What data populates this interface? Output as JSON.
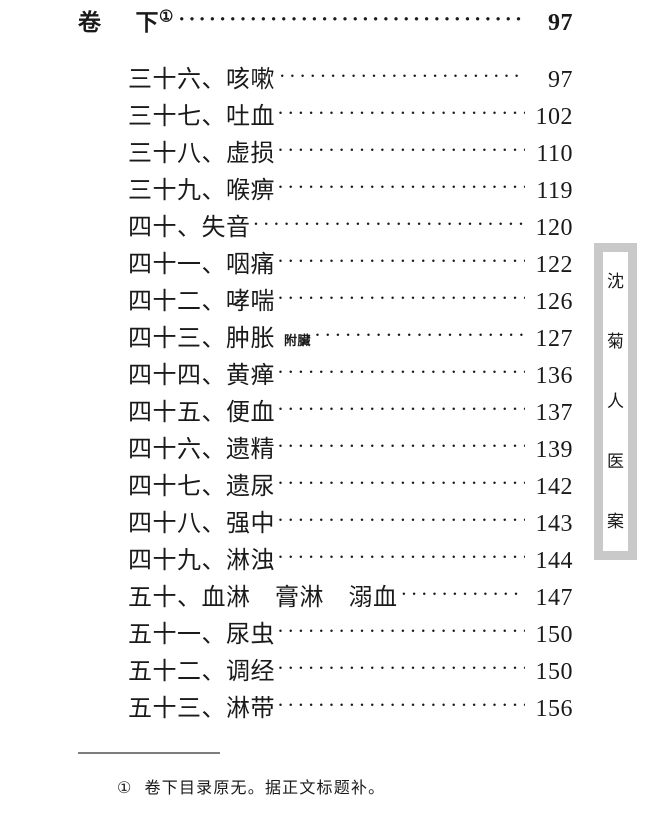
{
  "document": {
    "volume_header": {
      "prefix": "卷",
      "title": "下",
      "footnote_marker": "①",
      "page": "97"
    },
    "entries": [
      {
        "label": "三十六、咳嗽",
        "note": "",
        "page": "97",
        "pre_leader_gap": true
      },
      {
        "label": "三十七、吐血",
        "note": "",
        "page": "102",
        "pre_leader_gap": false
      },
      {
        "label": "三十八、虚损",
        "note": "",
        "page": "110",
        "pre_leader_gap": false
      },
      {
        "label": "三十九、喉痹",
        "note": "",
        "page": "119",
        "pre_leader_gap": false
      },
      {
        "label": "四十、失音",
        "note": "",
        "page": "120",
        "pre_leader_gap": false
      },
      {
        "label": "四十一、咽痛",
        "note": "",
        "page": "122",
        "pre_leader_gap": false
      },
      {
        "label": "四十二、哮喘",
        "note": "",
        "page": "126",
        "pre_leader_gap": false
      },
      {
        "label": "四十三、肿胀",
        "note": "附臟",
        "page": "127",
        "pre_leader_gap": false
      },
      {
        "label": "四十四、黄瘅",
        "note": "",
        "page": "136",
        "pre_leader_gap": false
      },
      {
        "label": "四十五、便血",
        "note": "",
        "page": "137",
        "pre_leader_gap": false
      },
      {
        "label": "四十六、遗精",
        "note": "",
        "page": "139",
        "pre_leader_gap": false
      },
      {
        "label": "四十七、遗尿",
        "note": "",
        "page": "142",
        "pre_leader_gap": false
      },
      {
        "label": "四十八、强中",
        "note": "",
        "page": "143",
        "pre_leader_gap": false
      },
      {
        "label": "四十九、淋浊",
        "note": "",
        "page": "144",
        "pre_leader_gap": false
      },
      {
        "label": "五十、血淋　膏淋　溺血",
        "note": "",
        "page": "147",
        "pre_leader_gap": true
      },
      {
        "label": "五十一、尿虫",
        "note": "",
        "page": "150",
        "pre_leader_gap": false
      },
      {
        "label": "五十二、调经",
        "note": "",
        "page": "150",
        "pre_leader_gap": false
      },
      {
        "label": "五十三、淋带",
        "note": "",
        "page": "156",
        "pre_leader_gap": false
      }
    ]
  },
  "side_title": {
    "text": "沈菊人医案",
    "characters": [
      "沈",
      "菊",
      "人",
      "医",
      "案"
    ],
    "border_color": "#c9c9c9"
  },
  "footnote": {
    "marker": "①",
    "text": "卷下目录原无。据正文标题补。",
    "rule_color": "#7d7d7d"
  }
}
